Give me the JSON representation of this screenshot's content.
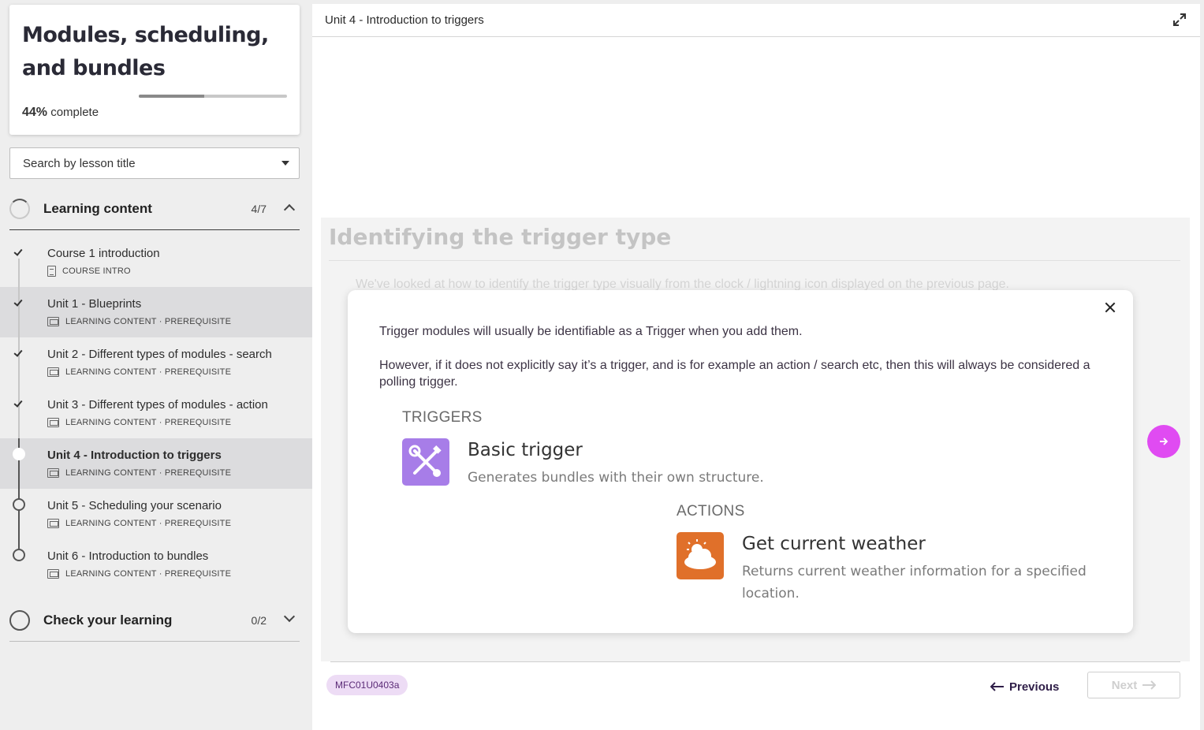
{
  "course": {
    "title": "Modules, scheduling, and bundles",
    "progress_value": "44%",
    "progress_suffix": "complete",
    "progress_fraction": 0.44
  },
  "search": {
    "placeholder": "Search by lesson title"
  },
  "sections": {
    "learning": {
      "label": "Learning content",
      "count": "4/7"
    },
    "check": {
      "label": "Check your learning",
      "count": "0/2"
    }
  },
  "lessons": [
    {
      "title": "Course 1 introduction",
      "meta": "COURSE INTRO",
      "status": "done"
    },
    {
      "title": "Unit 1 - Blueprints",
      "meta": "LEARNING CONTENT · PREREQUISITE",
      "status": "done"
    },
    {
      "title": "Unit 2 - Different types of modules - search",
      "meta": "LEARNING CONTENT · PREREQUISITE",
      "status": "done"
    },
    {
      "title": "Unit 3 - Different types of modules - action",
      "meta": "LEARNING CONTENT · PREREQUISITE",
      "status": "done"
    },
    {
      "title": "Unit 4 - Introduction to triggers",
      "meta": "LEARNING CONTENT · PREREQUISITE",
      "status": "current"
    },
    {
      "title": "Unit 5 - Scheduling your scenario",
      "meta": "LEARNING CONTENT · PREREQUISITE",
      "status": "todo"
    },
    {
      "title": "Unit 6 - Introduction to bundles",
      "meta": "LEARNING CONTENT · PREREQUISITE",
      "status": "todo"
    }
  ],
  "main": {
    "title": "Unit 4 - Introduction to triggers",
    "ghost_heading": "Identifying the trigger type",
    "ghost_paragraph": "We've looked at how to identify the trigger type visually from the clock / lightning icon displayed on the previous page."
  },
  "modal": {
    "paragraph1": "Trigger modules will usually be identifiable as a Trigger when you add them.",
    "paragraph2": "However, if it does not explicitly say it’s a trigger, and is for example an action / search etc, then this will always be considered a polling trigger.",
    "triggers_heading": "TRIGGERS",
    "trigger_name": "Basic trigger",
    "trigger_desc": "Generates bundles with their own structure.",
    "actions_heading": "ACTIONS",
    "action_name": "Get current weather",
    "action_desc": "Returns current weather information for a specified location."
  },
  "footer": {
    "code": "MFC01U0403a",
    "previous": "Previous",
    "next": "Next"
  },
  "colors": {
    "accent": "#e04bf2",
    "trigger_icon": "#a77de8",
    "weather_icon": "#e0702a",
    "badge_bg": "#eddcf5"
  }
}
